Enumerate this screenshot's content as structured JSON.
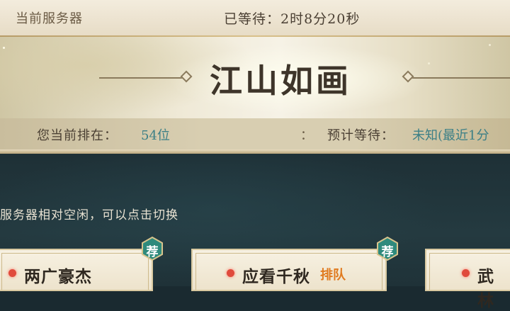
{
  "header": {
    "server_caption": "当前服务器",
    "wait_time": "已等待：2时8分20秒"
  },
  "banner": {
    "server_name": "江山如画"
  },
  "queue": {
    "position_label": "您当前排在：",
    "position_value": "54位",
    "separator": "：",
    "estimate_label": "预计等待：",
    "estimate_value": "未知(最近1分"
  },
  "hint": "服务器相对空闲，可以点击切换",
  "servers": [
    {
      "name": "两广豪杰",
      "tag": "",
      "recommended": true,
      "recommend_label": "荐",
      "status_color": "#e04a3c"
    },
    {
      "name": "应看千秋",
      "tag": "排队",
      "recommended": true,
      "recommend_label": "荐",
      "status_color": "#e04a3c"
    },
    {
      "name": "武林",
      "tag": "",
      "recommended": false,
      "status_color": "#e04a3c"
    }
  ],
  "colors": {
    "accent_teal": "#3b7f86",
    "queue_tag": "#e07a1f",
    "status_red": "#e04a3c",
    "badge_green": "#2e8a7c"
  }
}
